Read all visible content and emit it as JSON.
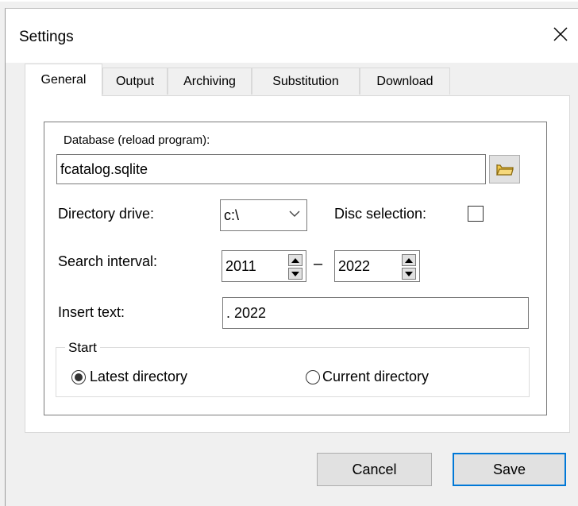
{
  "window": {
    "title": "Settings"
  },
  "tabs": [
    {
      "label": "General",
      "active": true
    },
    {
      "label": "Output",
      "active": false
    },
    {
      "label": "Archiving",
      "active": false
    },
    {
      "label": "Substitution",
      "active": false
    },
    {
      "label": "Download",
      "active": false
    }
  ],
  "general": {
    "database_label": "Database (reload program):",
    "database_value": "fcatalog.sqlite",
    "directory_drive_label": "Directory drive:",
    "directory_drive_value": "c:\\",
    "disc_selection_label": "Disc selection:",
    "disc_selection_checked": false,
    "search_interval_label": "Search interval:",
    "search_from": "2011",
    "search_separator": "–",
    "search_to": "2022",
    "insert_text_label": "Insert text:",
    "insert_text_value": ". 2022",
    "start": {
      "label": "Start",
      "options": [
        {
          "label": "Latest directory",
          "selected": true
        },
        {
          "label": "Current directory",
          "selected": false
        }
      ]
    }
  },
  "buttons": {
    "cancel": "Cancel",
    "save": "Save"
  },
  "colors": {
    "accent": "#0078d7",
    "folder_icon": "#f2c94c",
    "window_bg": "#f0f0f0"
  }
}
